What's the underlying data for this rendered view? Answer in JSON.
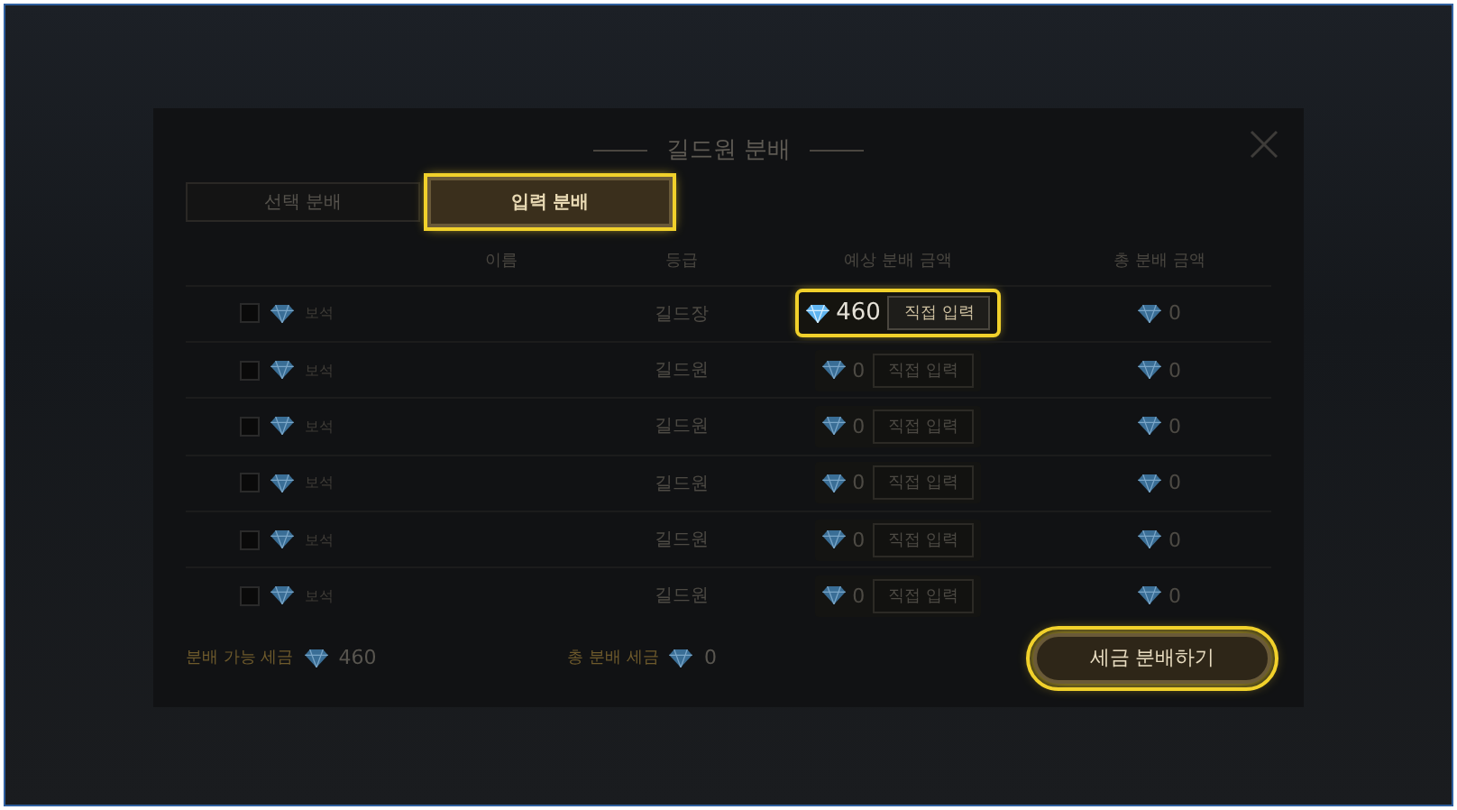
{
  "dialog": {
    "title": "길드원 분배"
  },
  "tabs": [
    {
      "label": "선택 분배",
      "selected": false
    },
    {
      "label": "입력 분배",
      "selected": true
    }
  ],
  "table": {
    "columns": [
      "이름",
      "등급",
      "예상 분배 금액",
      "총 분배 금액"
    ],
    "rows": [
      {
        "checked": false,
        "tag": "보석",
        "grade": "길드장",
        "amount": "460",
        "action": "직접 입력",
        "total": "0",
        "highlighted": true
      },
      {
        "checked": false,
        "tag": "보석",
        "grade": "길드원",
        "amount": "0",
        "action": "직접 입력",
        "total": "0",
        "highlighted": false
      },
      {
        "checked": false,
        "tag": "보석",
        "grade": "길드원",
        "amount": "0",
        "action": "직접 입력",
        "total": "0",
        "highlighted": false
      },
      {
        "checked": false,
        "tag": "보석",
        "grade": "길드원",
        "amount": "0",
        "action": "직접 입력",
        "total": "0",
        "highlighted": false
      },
      {
        "checked": false,
        "tag": "보석",
        "grade": "길드원",
        "amount": "0",
        "action": "직접 입력",
        "total": "0",
        "highlighted": false
      },
      {
        "checked": false,
        "tag": "보석",
        "grade": "길드원",
        "amount": "0",
        "action": "직접 입력",
        "total": "0",
        "highlighted": false
      }
    ]
  },
  "footer": {
    "available_label": "분배 가능 세금",
    "available": "460",
    "total_label": "총 분배 세금",
    "total": "0"
  },
  "submit": {
    "label": "세금 분배하기",
    "highlighted": true
  }
}
